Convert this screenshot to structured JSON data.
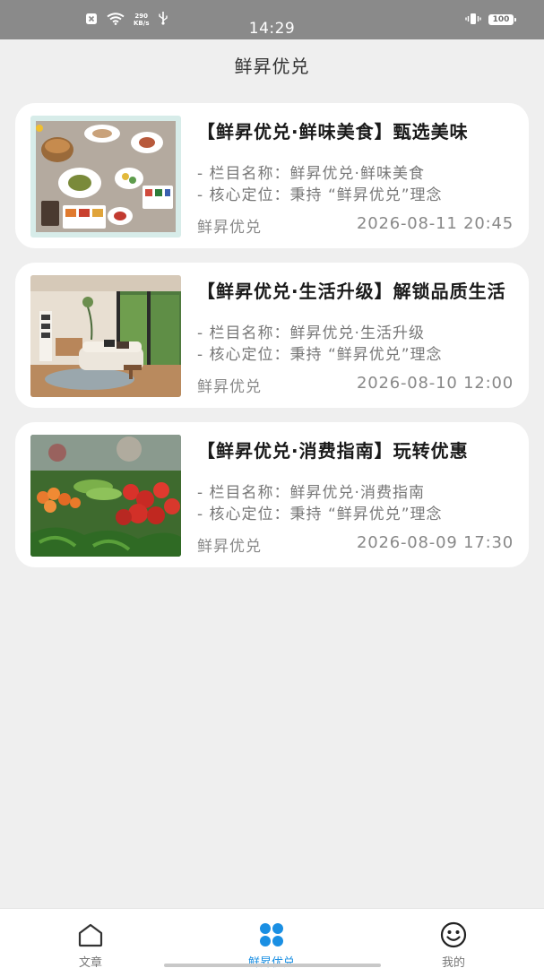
{
  "status_bar": {
    "time": "14:29",
    "net_speed_value": "290",
    "net_speed_unit": "KB/s",
    "battery": "100"
  },
  "header": {
    "title": "鲜昇优兑"
  },
  "articles": [
    {
      "title": "【鲜昇优兑·鲜味美食】甄选美味",
      "line1": "- 栏目名称：鲜昇优兑·鲜味美食",
      "line2": "- 核心定位：秉持 “鲜昇优兑”理念",
      "source": "鲜昇优兑",
      "date": "2026-08-11 20:45"
    },
    {
      "title": "【鲜昇优兑·生活升级】解锁品质生活",
      "line1": "- 栏目名称：鲜昇优兑·生活升级",
      "line2": "- 核心定位：秉持 “鲜昇优兑”理念",
      "source": "鲜昇优兑",
      "date": "2026-08-10 12:00"
    },
    {
      "title": "【鲜昇优兑·消费指南】玩转优惠",
      "line1": "- 栏目名称：鲜昇优兑·消费指南",
      "line2": "- 核心定位：秉持 “鲜昇优兑”理念",
      "source": "鲜昇优兑",
      "date": "2026-08-09 17:30"
    }
  ],
  "bottom_nav": {
    "items": [
      {
        "label": "文章",
        "icon": "home-icon",
        "active": false
      },
      {
        "label": "鲜昇优兑",
        "icon": "clover-icon",
        "active": true
      },
      {
        "label": "我的",
        "icon": "smiley-icon",
        "active": false
      }
    ]
  },
  "colors": {
    "accent": "#1a8fe3",
    "background": "#efefef",
    "status_bar": "#8a8a8a"
  }
}
